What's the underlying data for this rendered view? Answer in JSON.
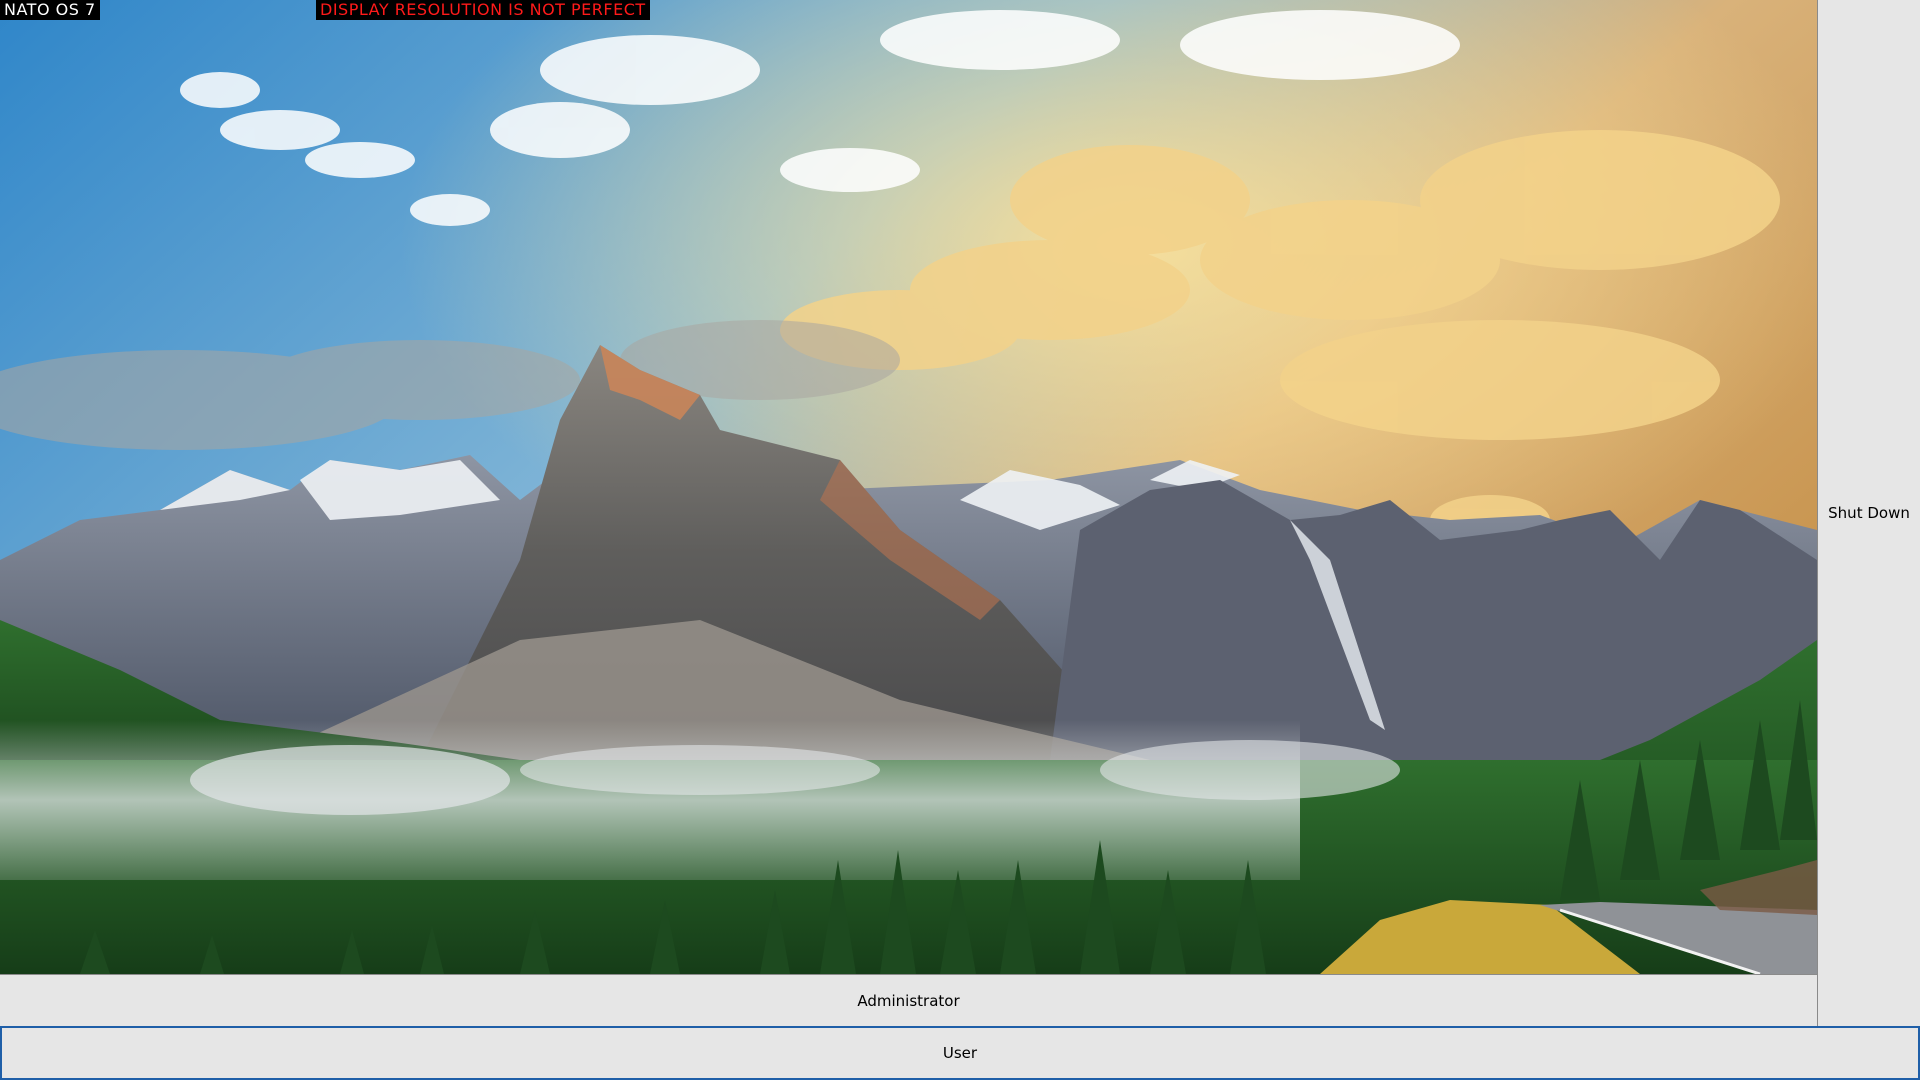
{
  "os": {
    "label": "NATO OS 7",
    "warning": "DISPLAY RESOLUTION IS NOT PERFECT",
    "warning_color": "#ff1a1a"
  },
  "wallpaper": {
    "subject": "mountain-landscape-wallpaper"
  },
  "login": {
    "administrator_label": "Administrator",
    "user_label": "User",
    "shutdown_label": "Shut Down",
    "selected_accent": "#1f5fa8"
  }
}
